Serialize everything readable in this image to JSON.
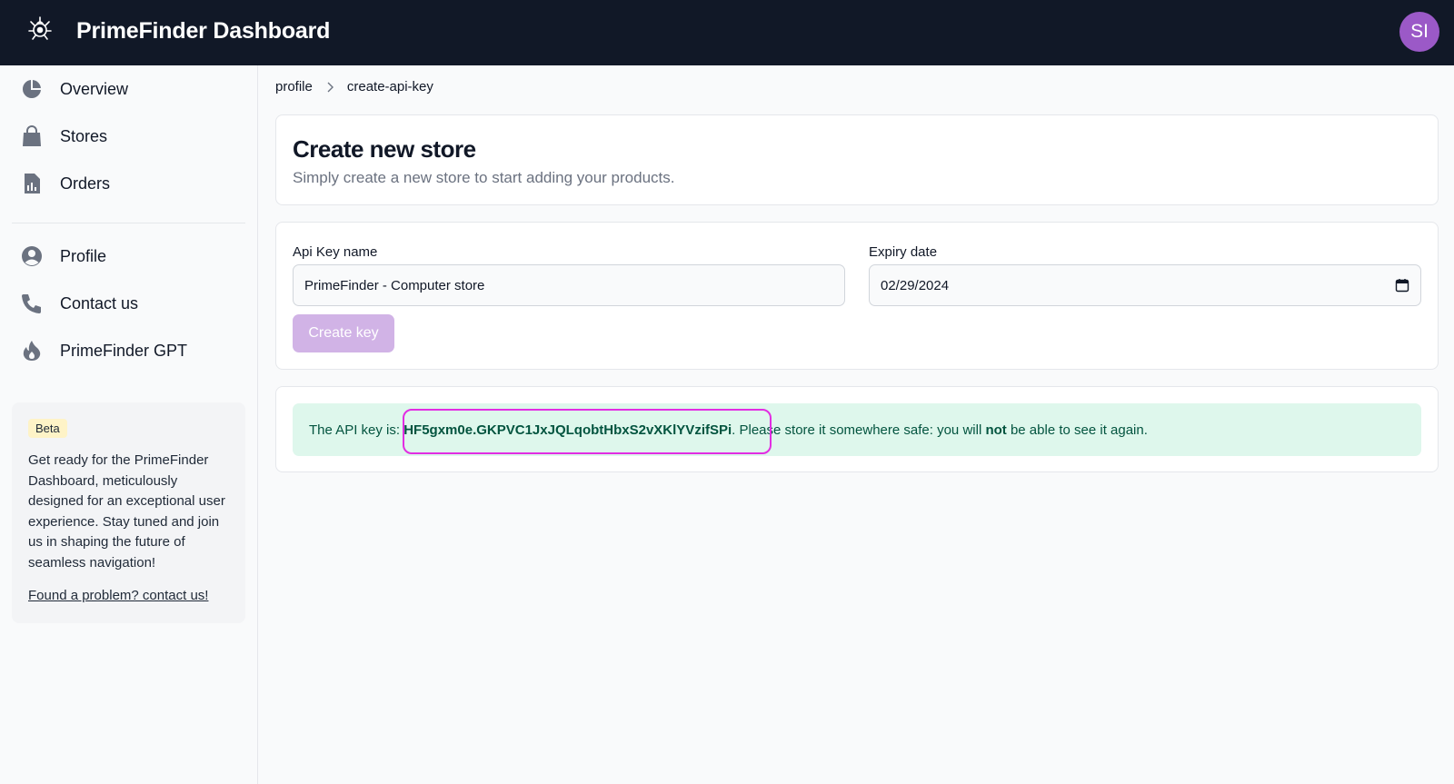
{
  "header": {
    "title": "PrimeFinder Dashboard",
    "avatar_initials": "SI",
    "logo_icon": "prime-logo-icon"
  },
  "sidebar": {
    "primary_items": [
      {
        "label": "Overview",
        "icon": "pie-chart-icon"
      },
      {
        "label": "Stores",
        "icon": "shopping-bag-icon"
      },
      {
        "label": "Orders",
        "icon": "document-chart-icon"
      }
    ],
    "secondary_items": [
      {
        "label": "Profile",
        "icon": "user-circle-icon"
      },
      {
        "label": "Contact us",
        "icon": "phone-icon"
      },
      {
        "label": "PrimeFinder GPT",
        "icon": "fire-icon"
      }
    ],
    "beta_card": {
      "badge": "Beta",
      "text": "Get ready for the PrimeFinder Dashboard, meticulously designed for an exceptional user experience. Stay tuned and join us in shaping the future of seamless navigation!",
      "link": "Found a problem? contact us!"
    }
  },
  "breadcrumb": [
    "profile",
    "create-api-key"
  ],
  "page": {
    "title": "Create new store",
    "subtitle": "Simply create a new store to start adding your products."
  },
  "form": {
    "api_key_name_label": "Api Key name",
    "api_key_name_value": "PrimeFinder - Computer store",
    "expiry_label": "Expiry date",
    "expiry_value": "02/29/2024",
    "submit_label": "Create key"
  },
  "result": {
    "prefix": "The API key is: ",
    "api_key": "HF5gxm0e.GKPVC1JxJQLqobtHbxS2vXKlYVzifSPi",
    "middle": ". Please store it somewhere safe: you will ",
    "emphasis": "not",
    "suffix": " be able to see it again."
  },
  "colors": {
    "header_bg": "#111827",
    "avatar_bg": "#9b59c7",
    "button_disabled_bg": "#d1b3e6",
    "alert_bg": "#def7ec",
    "alert_text": "#03543f",
    "highlight_border": "#e22ee2"
  }
}
